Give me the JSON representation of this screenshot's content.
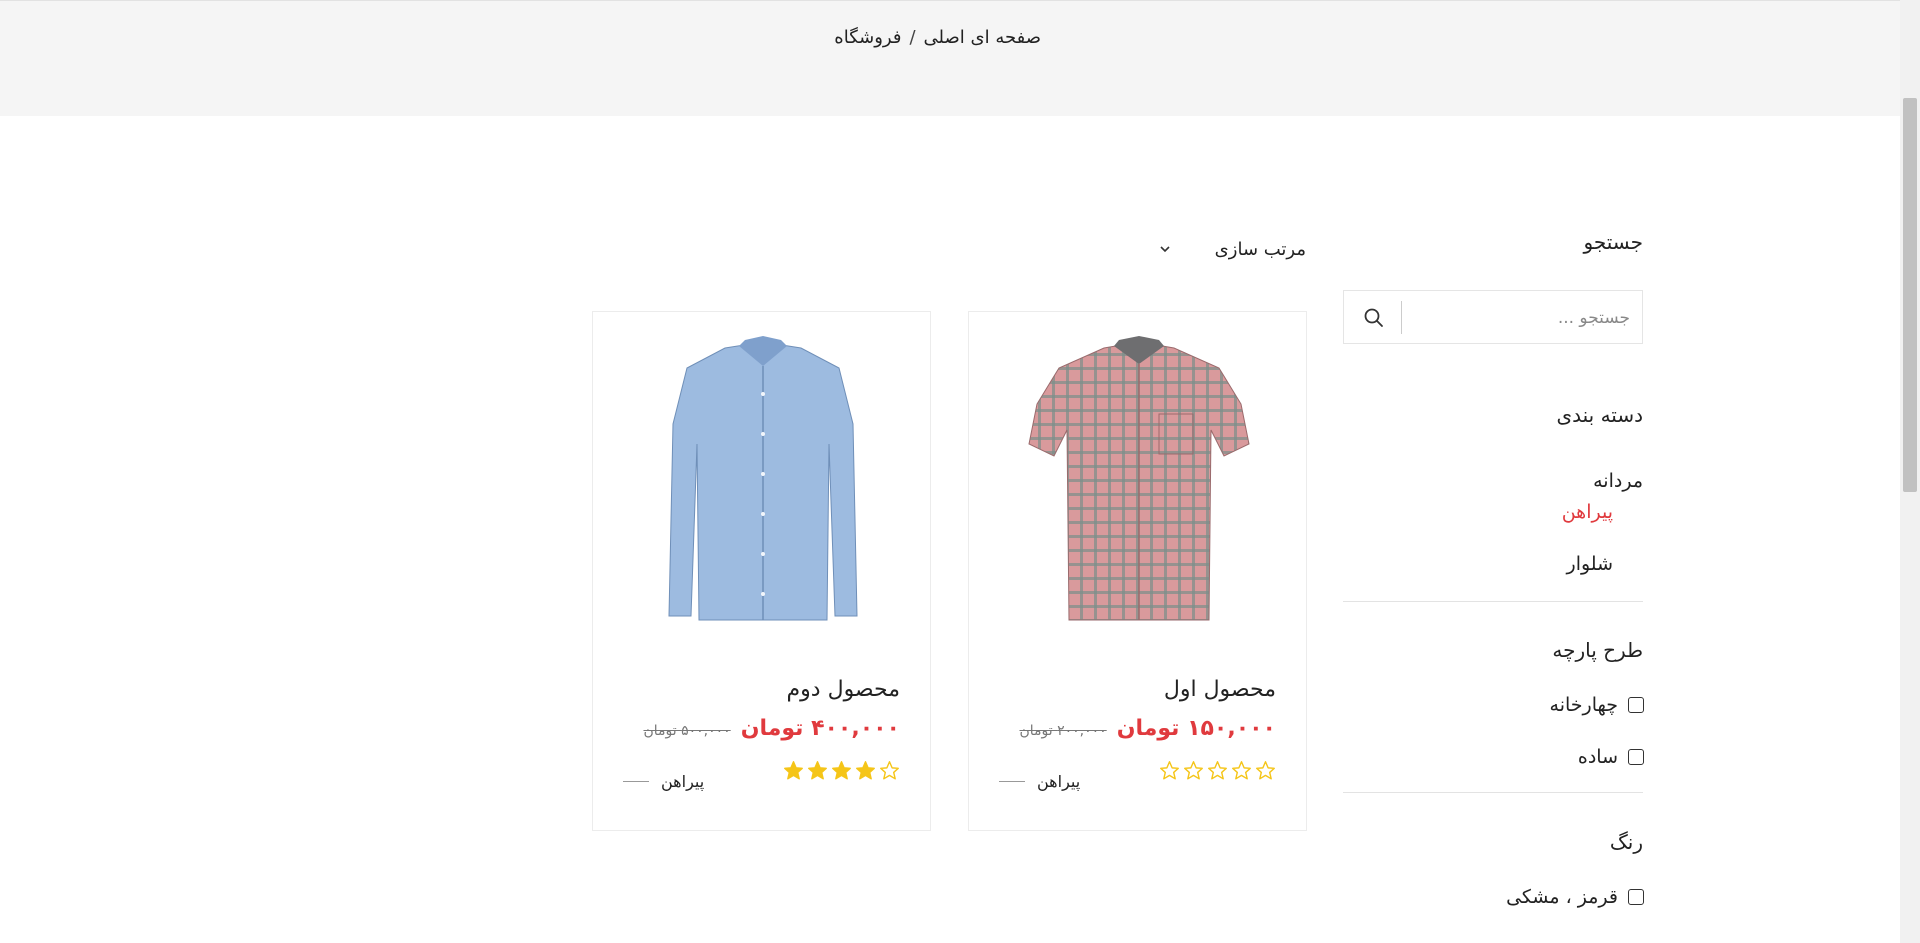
{
  "breadcrumb": {
    "home": "صفحه ای اصلی",
    "separator": "/",
    "current": "فروشگاه"
  },
  "search": {
    "title": "جستجو",
    "placeholder": "جستجو ..."
  },
  "categories": {
    "title": "دسته بندی",
    "items": [
      {
        "label": "مردانه",
        "color": "#222222"
      },
      {
        "label": "پیراهن",
        "color": "#e03a3e",
        "active": true
      },
      {
        "label": "شلوار",
        "color": "#222222"
      }
    ]
  },
  "fabric_pattern": {
    "title": "طرح پارچه",
    "options": [
      "چهارخانه",
      "ساده"
    ]
  },
  "color_filter": {
    "title": "رنگ",
    "options": [
      "قرمز ، مشکی"
    ]
  },
  "sort": {
    "label": "مرتب سازی"
  },
  "products": [
    {
      "name": "محصول اول",
      "price": "۱۵۰,۰۰۰ تومان",
      "old_price": "۲۰۰,۰۰۰ تومان",
      "rating": 0,
      "rating_max": 5,
      "category": "پیراهن",
      "image": "plaid-shirt"
    },
    {
      "name": "محصول دوم",
      "price": "۴۰۰,۰۰۰ تومان",
      "old_price": "۵۰۰,۰۰۰ تومان",
      "rating": 4,
      "rating_max": 5,
      "category": "پیراهن",
      "image": "blue-shirt"
    }
  ],
  "colors": {
    "accent": "#e03a3e",
    "star": "#f5c518",
    "topbar_bg": "#f5f5f5"
  }
}
